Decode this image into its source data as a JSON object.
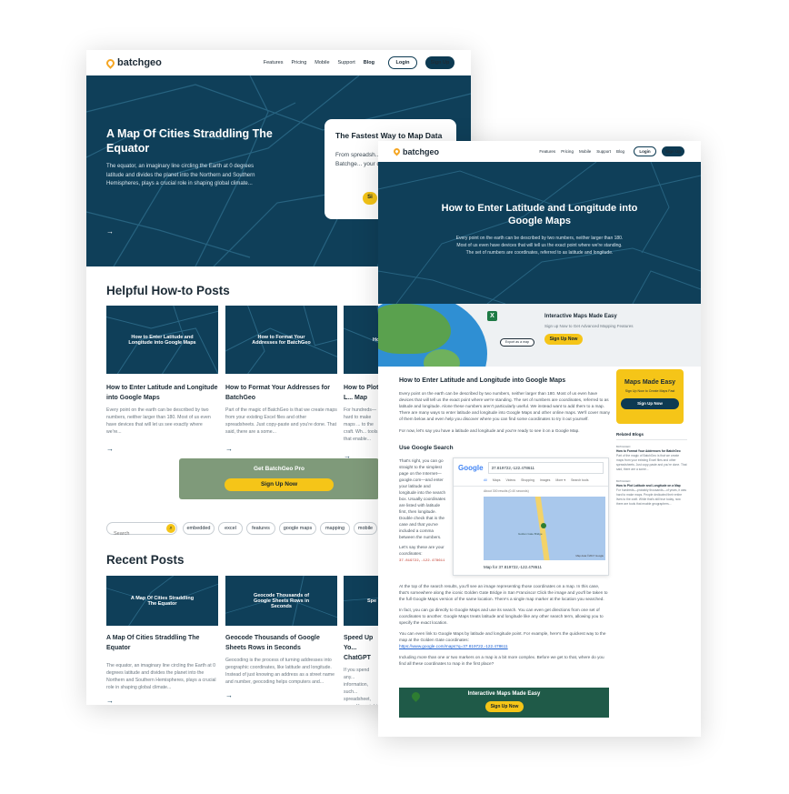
{
  "brand": "batchgeo",
  "nav": [
    "Features",
    "Pricing",
    "Mobile",
    "Support",
    "Blog"
  ],
  "login": "Login",
  "signup": "Sign Up",
  "back": {
    "hero_title": "A Map Of Cities Straddling The Equator",
    "hero_text": "The equator, an imaginary line circling the Earth at 0 degrees latitude and divides the planet into the Northern and Southern Hemispheres, plays a crucial role in shaping global climate...",
    "promo_title": "The Fastest Way to Map Data",
    "promo_text": "From spreadsh... steps. Batchge... your data in...",
    "promo_btn": "Si",
    "howto_heading": "Helpful How-to Posts",
    "howto": [
      {
        "thumb": "How to Enter Latitude and Longitude into Google Maps",
        "title": "How to Enter Latitude and Longitude into Google Maps",
        "excerpt": "Every point on the earth can be described by two numbers, neither larger than 180. Most of us even have devices that will let us see exactly where we're..."
      },
      {
        "thumb": "How to Format Your Addresses for BatchGeo",
        "title": "How to Format Your Addresses for BatchGeo",
        "excerpt": "Part of the magic of BatchGeo is that we create maps from your existing Excel files and other spreadsheets. Just copy-paste and you're done. That said, there are a some..."
      },
      {
        "thumb": "Ho",
        "title": "How to Plot L... Map",
        "excerpt": "For hundreds— hard to make maps ... to the craft. Wh... tools that enable..."
      }
    ],
    "pro_title": "Get BatchGeo Pro",
    "pro_btn": "Sign Up Now",
    "search_placeholder": "Search",
    "tags": [
      "embedded",
      "excel",
      "features",
      "google maps",
      "mapping",
      "mobile"
    ],
    "recent_heading": "Recent Posts",
    "recent": [
      {
        "thumb": "A Map Of Cities Straddling The Equator",
        "title": "A Map Of Cities Straddling The Equator",
        "excerpt": "The equator, an imaginary line circling the Earth at 0 degrees latitude and divides the planet into the Northern and Southern Hemispheres, plays a crucial role in shaping global climate..."
      },
      {
        "thumb": "Geocode Thousands of Google Sheets Rows in Seconds",
        "title": "Geocode Thousands of Google Sheets Rows in Seconds",
        "excerpt": "Geocoding is the process of turning addresses into geographic coordinates, like latitude and longitude. Instead of just knowing an address as a street name and number, geocoding helps computers and..."
      },
      {
        "thumb": "Spe",
        "title": "Speed Up Yo... ChatGPT",
        "excerpt": "If you spend any... information, such... spreadsheet, you... You might find yo..."
      }
    ]
  },
  "front": {
    "hero_title": "How to Enter Latitude and Longitude into Google Maps",
    "hero_text": "Every point on the earth can be described by two numbers, neither larger than 180. Most of us even have devices that will tell us the exact point where we're standing. The set of numbers are coordinates, referred to as latitude and longitude.",
    "banner_title": "Interactive Maps Made Easy",
    "banner_sub": "Sign up Now to Get Advanced Mapping Features",
    "banner_btn": "Sign Up Now",
    "export_label": "Export as a map",
    "article_title": "How to Enter Latitude and Longitude into Google Maps",
    "p1": "Every point on the earth can be described by two numbers, neither larger than 180. Most of us even have devices that will tell us the exact point where we're standing. The set of numbers are coordinates, referred to as latitude and longitude. Alone these numbers aren't particularly useful. We instead want to add them to a map. There are many ways to enter latitude and longitude into Google Maps and other online maps. We'll cover many of them below and even help you discover where you can find some coordinates to try it out yourself.",
    "p2": "For now, let's say you have a latitude and longitude and you're ready to see it on a Google Map.",
    "h2": "Use Google Search",
    "p3": "That's right, you can go straight to the simplest page on the Internet—google.com—and enter your latitude and longitude into the search box. Usually coordinates are listed with latitude first, then longitude. Double check that is the case and that you've included a comma between the numbers.",
    "p4": "Let's say these are your coordinates:",
    "coords": "37.819722,-122.478611",
    "p5": "At the top of the search results, you'll see an image representing those coordinates on a map. In this case, that's somewhere along the iconic Golden Gate Bridge in San Francisco! Click the image and you'll be taken to the full Google Maps version of the same location. There's a single map marker at the location you searched.",
    "p6": "In fact, you can go directly to Google Maps and use its search. You can even get directions from one set of coordinates to another. Google Maps treats latitude and longitude like any other search term, allowing you to specify the exact location.",
    "p7": "You can even link to Google Maps by latitude and longitude point. For example, here's the quickest way to the map at the Golden Gate coordinates:",
    "link": "https://www.google.com/maps?q=37.819722,-122.478611",
    "p8": "Including more than one or two markers on a map is a bit more complex. Before we get to that, where do you find all these coordinates to map in the first place?",
    "google": {
      "logo": "Google",
      "query": "37.819722,-122.478611",
      "tabs": [
        "All",
        "Maps",
        "Videos",
        "Shopping",
        "Images",
        "More ▾",
        "Search tools"
      ],
      "results": "About 300 results (0.40 seconds)",
      "map_place": "Golden Gate Bridge",
      "map_footer": "Map data ©2017 Google",
      "caption": "Map for 37.819722,-122.478611"
    },
    "side_title": "Maps Made Easy",
    "side_sub": "Sign Up Now to Create Maps Fast",
    "side_btn": "Sign Up Now",
    "related": "Related Blogs",
    "related_items": [
      {
        "tag": "BATCHGEO",
        "title": "How to Format Your Addresses for BatchGeo",
        "excerpt": "Part of the magic of BatchGeo is that we create maps from your existing Excel files and other spreadsheets. Just copy-paste and you're done. That said, there are a some..."
      },
      {
        "tag": "BATCHGEO",
        "title": "How to Plot Latitude and Longitude on a Map",
        "excerpt": "For hundreds—probably thousands—of years, it was hard to make maps. People dedicated their entire lives to the craft. While that's still true today, now there are tools that enable geographers..."
      }
    ],
    "bottom_title": "Interactive Maps Made Easy",
    "bottom_btn": "Sign Up Now"
  },
  "colors": {
    "navy": "#0f3f59",
    "yellow": "#f5c518",
    "accent": "#f5a623"
  }
}
